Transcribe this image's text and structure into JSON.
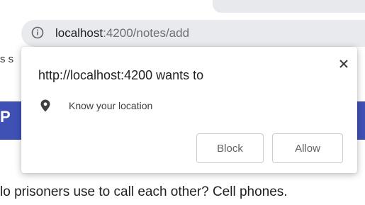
{
  "browser": {
    "url_host": "localhost",
    "url_path": ":4200/notes/add"
  },
  "page": {
    "left_fragment": "s s",
    "band_letter": "P",
    "joke_text": "lo prisoners use to call each other? Cell phones."
  },
  "permission_prompt": {
    "title": "http://localhost:4200 wants to",
    "permission_label": "Know your location",
    "permission_icon": "location-pin-icon",
    "close_icon": "close-icon",
    "block_label": "Block",
    "allow_label": "Allow"
  },
  "colors": {
    "band": "#3f51b5",
    "omnibox": "#e9eaed"
  }
}
